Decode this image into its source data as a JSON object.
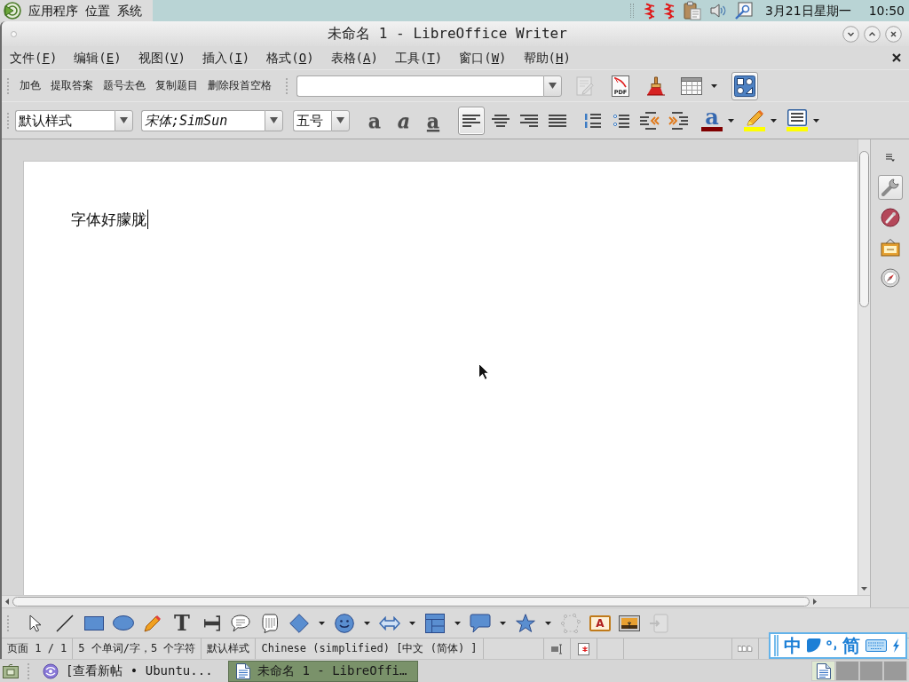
{
  "top_panel": {
    "menus": [
      "应用程序",
      "位置",
      "系统"
    ],
    "date": "3月21日星期一",
    "time": "10:50"
  },
  "window": {
    "title": "未命名 1 - LibreOffice Writer"
  },
  "menu_bar": {
    "items": [
      {
        "before": "文件(",
        "mnemonic": "F",
        "after": ")"
      },
      {
        "before": "编辑(",
        "mnemonic": "E",
        "after": ")"
      },
      {
        "before": "视图(",
        "mnemonic": "V",
        "after": ")"
      },
      {
        "before": "插入(",
        "mnemonic": "I",
        "after": ")"
      },
      {
        "before": "格式(",
        "mnemonic": "O",
        "after": ")"
      },
      {
        "before": "表格(",
        "mnemonic": "A",
        "after": ")"
      },
      {
        "before": "工具(",
        "mnemonic": "T",
        "after": ")"
      },
      {
        "before": "窗口(",
        "mnemonic": "W",
        "after": ")"
      },
      {
        "before": "帮助(",
        "mnemonic": "H",
        "after": ")"
      }
    ]
  },
  "macro_toolbar": {
    "buttons": [
      "加色",
      "提取答案",
      "题号去色",
      "复制题目",
      "删除段首空格"
    ]
  },
  "standard_toolbar": {
    "tools": [
      {
        "kind": "edit",
        "disabled": true,
        "selected": false,
        "dropdown": false
      },
      {
        "kind": "pdf",
        "label": "PDF",
        "disabled": false,
        "selected": false,
        "dropdown": false
      },
      {
        "kind": "clone",
        "disabled": false,
        "selected": false,
        "dropdown": false
      },
      {
        "kind": "table",
        "disabled": false,
        "selected": false,
        "dropdown": true
      },
      {
        "kind": "design",
        "disabled": false,
        "selected": true,
        "dropdown": false
      }
    ]
  },
  "formatting_toolbar": {
    "paragraph_style": "默认样式",
    "font_name": "宋体;SimSun",
    "font_size": "五号",
    "char_buttons": [
      {
        "kind": "bold",
        "glyph": "a"
      },
      {
        "kind": "italic",
        "glyph": "a"
      },
      {
        "kind": "underline",
        "glyph": "a"
      }
    ],
    "align_buttons": [
      {
        "kind": "left",
        "selected": true
      },
      {
        "kind": "center",
        "selected": false
      },
      {
        "kind": "right",
        "selected": false
      },
      {
        "kind": "justify",
        "selected": false
      }
    ],
    "list_buttons": [
      {
        "kind": "numbering"
      },
      {
        "kind": "bullets"
      },
      {
        "kind": "outdent"
      },
      {
        "kind": "indent"
      }
    ],
    "color_buttons": [
      {
        "kind": "font-color",
        "glyph": "a",
        "color": "#800000"
      },
      {
        "kind": "highlight",
        "color": "#ffff00"
      },
      {
        "kind": "background",
        "color": "#ffff00"
      }
    ]
  },
  "document": {
    "text": "字体好朦胧"
  },
  "sidebar": {
    "tools": [
      {
        "kind": "menu",
        "selected": false
      },
      {
        "kind": "properties",
        "selected": true
      },
      {
        "kind": "gallery",
        "selected": false
      },
      {
        "kind": "navigator",
        "selected": false
      },
      {
        "kind": "compass",
        "selected": false
      }
    ]
  },
  "drawing_toolbar": {
    "tools": [
      {
        "kind": "select",
        "disabled": false,
        "dropdown": false
      },
      {
        "kind": "line",
        "disabled": false,
        "dropdown": false
      },
      {
        "kind": "rectangle",
        "disabled": false,
        "dropdown": false
      },
      {
        "kind": "ellipse",
        "disabled": false,
        "dropdown": false
      },
      {
        "kind": "freeform",
        "disabled": false,
        "dropdown": false
      },
      {
        "kind": "text",
        "glyph": "T",
        "disabled": false,
        "dropdown": false
      },
      {
        "kind": "vertical-text",
        "glyph": "T",
        "disabled": false,
        "dropdown": false
      },
      {
        "kind": "callout",
        "disabled": false,
        "dropdown": false
      },
      {
        "kind": "vertical-callout",
        "disabled": false,
        "dropdown": false
      },
      {
        "kind": "basic-shapes",
        "disabled": false,
        "dropdown": true
      },
      {
        "kind": "symbol-shapes",
        "disabled": false,
        "dropdown": true
      },
      {
        "kind": "block-arrows",
        "disabled": false,
        "dropdown": true
      },
      {
        "kind": "flowchart",
        "disabled": false,
        "dropdown": true
      },
      {
        "kind": "callout-shapes",
        "disabled": false,
        "dropdown": true
      },
      {
        "kind": "stars",
        "disabled": false,
        "dropdown": true
      },
      {
        "kind": "points",
        "disabled": true,
        "dropdown": false
      },
      {
        "kind": "fontwork",
        "glyph": "A",
        "disabled": false,
        "dropdown": false
      },
      {
        "kind": "image",
        "disabled": false,
        "dropdown": false
      },
      {
        "kind": "extrusion",
        "disabled": true,
        "dropdown": false
      }
    ]
  },
  "status_bar": {
    "page": "页面 1 / 1",
    "word_count": "5 个单词/字，5 个字符",
    "page_style": "默认样式",
    "language": "Chinese (simplified) [中文 (简体) ]"
  },
  "input_method": {
    "mode": "中",
    "script": "简"
  },
  "taskbar": {
    "tasks": [
      {
        "kind": "browser",
        "label": "[查看新帖 • Ubuntu...",
        "selected": false
      },
      {
        "kind": "writer",
        "label": "未命名 1 - LibreOffi…",
        "selected": true
      }
    ],
    "workspaces": [
      {
        "selected": true,
        "has_window": true
      },
      {
        "selected": false,
        "has_window": false
      },
      {
        "selected": false,
        "has_window": false
      },
      {
        "selected": false,
        "has_window": false
      }
    ]
  }
}
